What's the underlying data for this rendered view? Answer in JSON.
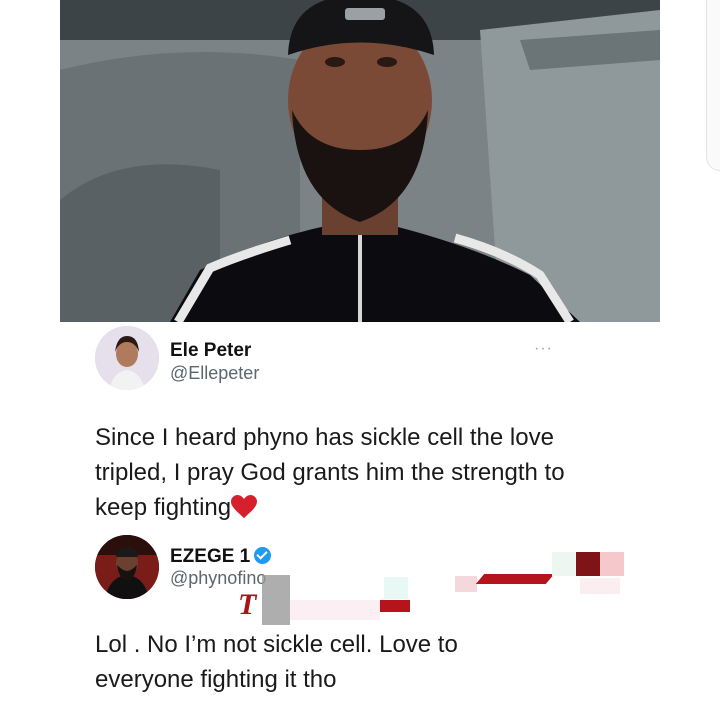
{
  "tweet1": {
    "name": "Ele Peter",
    "handle": "@Ellepeter",
    "more": "···",
    "text": "Since I heard phyno has sickle cell the love tripled, I pray God grants him the strength to keep fighting",
    "emoji": "heart-emoji"
  },
  "tweet2": {
    "name": "EZEGE 1",
    "handle": "@phynofino",
    "text": "Lol . No I’m not sickle cell. Love to everyone fighting it tho"
  },
  "colors": {
    "handle": "#5b6670",
    "verified": "#1d9bf0",
    "heart": "#d6202e"
  }
}
